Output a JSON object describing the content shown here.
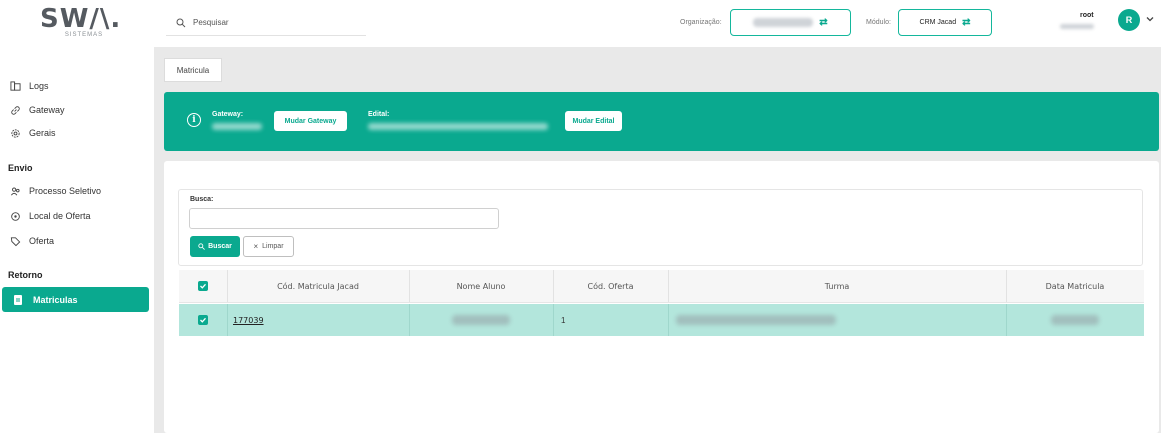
{
  "logo": {
    "main": "SW/\\.",
    "sub": "SISTEMAS"
  },
  "sidebar": {
    "items": [
      {
        "label": "Logs",
        "icon": "logs-icon"
      },
      {
        "label": "Gateway",
        "icon": "link-icon"
      },
      {
        "label": "Gerais",
        "icon": "gear-icon"
      }
    ],
    "section_envio": "Envio",
    "envio_items": [
      {
        "label": "Processo Seletivo",
        "icon": "users-icon"
      },
      {
        "label": "Local de Oferta",
        "icon": "location-icon"
      },
      {
        "label": "Oferta",
        "icon": "tag-icon"
      }
    ],
    "section_retorno": "Retorno",
    "active_item": {
      "label": "Matriculas",
      "icon": "document-icon"
    }
  },
  "header": {
    "search_placeholder": "Pesquisar",
    "org_label": "Organização:",
    "module_label": "Módulo:",
    "module_value": "CRM Jacad",
    "user_name": "root",
    "avatar_letter": "R"
  },
  "page": {
    "tab_label": "Matricula",
    "banner": {
      "gateway_label": "Gateway:",
      "gateway_button": "Mudar Gateway",
      "edital_label": "Edital:",
      "edital_button": "Mudar Edital"
    },
    "filter": {
      "busca_label": "Busca:",
      "search_button": "Buscar",
      "clear_button": "Limpar"
    },
    "table": {
      "headers": [
        "Cód. Matricula Jacad",
        "Nome Aluno",
        "Cód. Oferta",
        "Turma",
        "Data Matricula"
      ],
      "rows": [
        {
          "cod_matricula": "177039",
          "cod_oferta": "1"
        }
      ]
    }
  },
  "colors": {
    "accent": "#0aa98f",
    "row_selected": "#b3e6dc",
    "page_bg": "#e9e9e9"
  }
}
